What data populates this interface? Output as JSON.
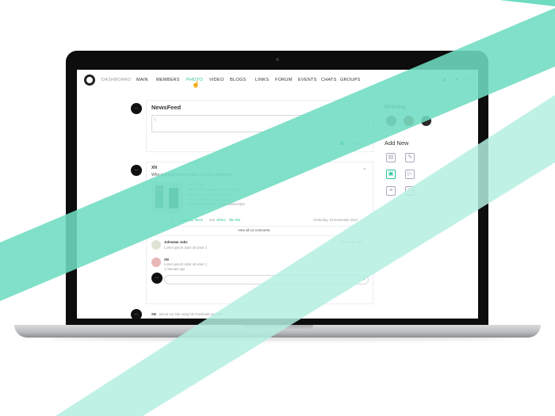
{
  "nav": {
    "items": [
      "DASHBOARD",
      "MAIN",
      "MEMBERS",
      "PHOTO",
      "VIDEO",
      "BLOGS",
      "LINKS",
      "FORUM",
      "EVENTS",
      "CHATS",
      "GROUPS"
    ],
    "active_item": "PHOTO"
  },
  "newsfeed": {
    "title": "NewsFeed",
    "post_label": "POST"
  },
  "post": {
    "author": "XN",
    "question": "Who watched Harry Potter over the weekend?",
    "media": {
      "title": "Harry Potter",
      "line1": "Description: Aenean sit risus, viverra",
      "line2": "at faucibus id, molestie et eros.",
      "line3": "Ullamco laboris nisi ut aliquip",
      "line4": "Subject: Proin diam metus, ullamcorper"
    },
    "likes": "15",
    "comments_count": "12",
    "liked_by_names": "Sabrina, Ikene",
    "liked_by_and": "and",
    "liked_by_others": "others",
    "liked_by_suffix": "like this",
    "date": "Yesterday, 16 November 2012",
    "view_all": "View all 12 comments",
    "comments": [
      {
        "author": "Johnatan Jobs",
        "text": "Lorem ipsum dolor sit amet :)",
        "time": "30 minutes ago"
      },
      {
        "author": "XN",
        "text": "Lorem ipsum dolor sit amet :)",
        "time": "1 minutes ago"
      }
    ]
  },
  "post2": {
    "author": "XN",
    "text": "joined our site using his Facebook account!"
  },
  "sidebar": {
    "birthday_title": "Birthday",
    "add_new_title": "Add New"
  },
  "colors": {
    "accent": "#27c29a",
    "stripe": "#6fdcc2",
    "stripe_light": "#b4efe1"
  }
}
